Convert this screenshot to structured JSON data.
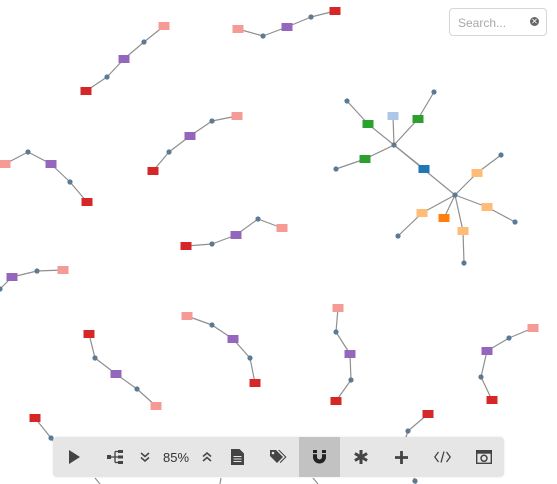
{
  "search": {
    "placeholder": "Search..."
  },
  "toolbar": {
    "zoom_level": "85%",
    "buttons": [
      "play",
      "layout",
      "zoom-out",
      "zoom-in",
      "notes",
      "tags",
      "magnet",
      "asterisk",
      "add",
      "code",
      "screenshot"
    ],
    "active_button": "magnet"
  },
  "colors": {
    "edge": "#8f8f8f",
    "dot": "#5c7a94",
    "salmon": "#f59a94",
    "purple": "#9467bd",
    "red": "#d62728",
    "green": "#2ca02c",
    "light_blue": "#aec7e8",
    "blue": "#1f77b4",
    "light_orange": "#ffbb78",
    "orange": "#ff7f0e"
  }
}
